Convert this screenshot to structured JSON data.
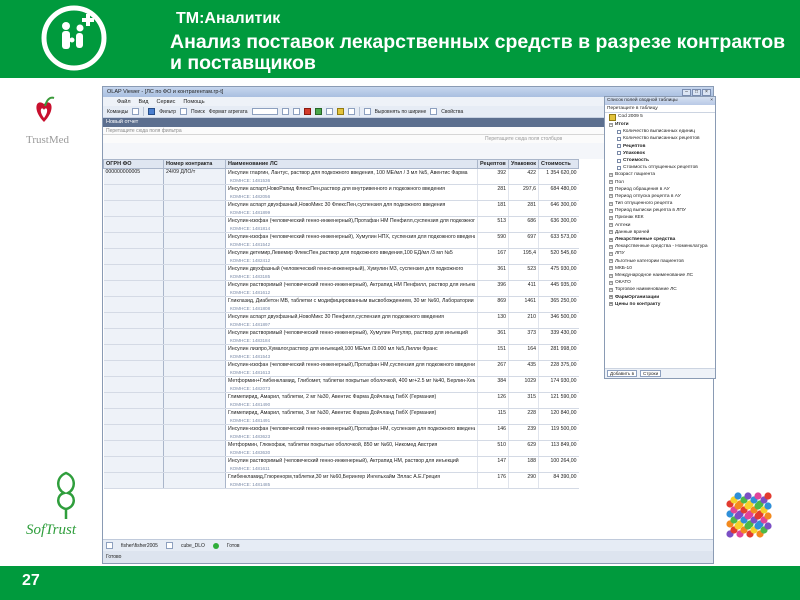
{
  "slide": {
    "app_name": "ТМ:Аналитик",
    "title": "Анализ поставок лекарственных средств в разрезе контрактов и поставщиков",
    "page_number": "27",
    "trustmed_label": "TrustMed",
    "softtrust_label": "SofTrust",
    "colors": {
      "brand_green": "#009a3d",
      "window_frame": "#8a9bb4"
    }
  },
  "window": {
    "title": "OLAP Viewer - [ЛС по ФО и контрагентам.rp-t]",
    "menu": [
      "Файл",
      "Вид",
      "Сервис",
      "Помощь"
    ],
    "toolbar": {
      "commands": "Команды",
      "filter": "Фильтр",
      "search": "Поиск",
      "format": "Формат агрегата",
      "align": "Выровнять по ширине",
      "properties": "Свойства"
    },
    "report_tab": "Новый отчет",
    "filter_zone": "Перетащите сюда поля фильтра",
    "column_zone": "Перетащите сюда поля столбцов",
    "headers": {
      "ogrn": "ОГРН ФО",
      "contract": "Номер контракта",
      "name": "Наименование ЛС",
      "recipes": "Рецептов",
      "packs": "Упаковок",
      "cost": "Стоимость"
    },
    "ogrn_value": "000000000005",
    "contract_value": "24/09 ДЛО/т",
    "rows": [
      {
        "name": "Инсулин гларгин, Лантус, раствор для подкожного введения, 100 МЕ/мл / 3 мл №5, Авентис Фарма",
        "code": "КОМНСЕ: 1481536",
        "recipes": "392",
        "packs": "422",
        "cost": "1 354 620,00"
      },
      {
        "name": "Инсулин аспарт,НовоРапид ФлексПен,раствор для внутривенного и подкожного введения",
        "code": "КОМНСЕ: 1482056",
        "recipes": "281",
        "packs": "297,6",
        "cost": "684 480,00"
      },
      {
        "name": "Инсулин аспарт двухфазный,НовоМикс 30 ФлексПен,суспензия для подкожного введения",
        "code": "КОМНСЕ: 1481899",
        "recipes": "181",
        "packs": "281",
        "cost": "646 300,00"
      },
      {
        "name": "Инсулин-изофан (человеческий генно-инженерный),Протафан НМ Пенфилл,суспензия для подкожного",
        "code": "КОМНСЕ: 1481814",
        "recipes": "513",
        "packs": "686",
        "cost": "636 300,00"
      },
      {
        "name": "Инсулин-изофан (человеческий генно-инженерный), Хумулин НПХ, суспензия для подкожного введения",
        "code": "КОМНСЕ: 1481542",
        "recipes": "590",
        "packs": "697",
        "cost": "633 573,00"
      },
      {
        "name": "Инсулин детемир,Левемир ФлексПен,раствор для подкожного введения,100 ЕД/мл /3 мл №5",
        "code": "КОМНСЕ: 1482412",
        "recipes": "167",
        "packs": "195,4",
        "cost": "520 545,60"
      },
      {
        "name": "Инсулин двухфазный (человеческий генно-инженерный), Хумулин М3, суспензия для подкожного",
        "code": "КОМНСЕ: 1483185",
        "recipes": "361",
        "packs": "523",
        "cost": "475 930,00"
      },
      {
        "name": "Инсулин растворимый (человеческий генно-инженерный), Актрапид НМ Пенфилл, раствор для инъекций",
        "code": "КОМНСЕ: 1481612",
        "recipes": "396",
        "packs": "411",
        "cost": "445 935,00"
      },
      {
        "name": "Гликлазид, Диабетон МВ, таблетки с модифицированным высвобождением, 30 мг №60, Лаборатории Сервье",
        "code": "КОМНСЕ: 1481808",
        "recipes": "869",
        "packs": "1461",
        "cost": "365 250,00"
      },
      {
        "name": "Инсулин аспарт двухфазный,НовоМикс 30 Пенфилл,суспензия для подкожного введения",
        "code": "КОМНСЕ: 1481897",
        "recipes": "130",
        "packs": "210",
        "cost": "346 500,00"
      },
      {
        "name": "Инсулин растворимый (человеческий генно-инженерный), Хумулин Регуляр, раствор для инъекций",
        "code": "КОМНСЕ: 1483184",
        "recipes": "361",
        "packs": "373",
        "cost": "339 430,00"
      },
      {
        "name": "Инсулин лизпро,Хумалог,раствор для инъекций,100 МЕ/мл /3.000 мл №5,Лилли Франс",
        "code": "КОМНСЕ: 1481543",
        "recipes": "151",
        "packs": "164",
        "cost": "281 998,00"
      },
      {
        "name": "Инсулин-изофан (человеческий генно-инженерный),Протафан НМ,суспензия для подкожного введения",
        "code": "КОМНСЕ: 1481613",
        "recipes": "267",
        "packs": "435",
        "cost": "228 375,00"
      },
      {
        "name": "Метформин+Глибенкламид, Глибомет, таблетки покрытые оболочкой, 400 мг+2.5 мг №40, Берлин-Хеми",
        "code": "КОМНСЕ: 1482073",
        "recipes": "384",
        "packs": "1029",
        "cost": "174 930,00"
      },
      {
        "name": "Глимепирид, Амарил, таблетки, 2 мг №30, Авентис Фарма Дойчланд ГмбХ (Германия)",
        "code": "КОМНСЕ: 1481490",
        "recipes": "126",
        "packs": "315",
        "cost": "121 590,00"
      },
      {
        "name": "Глимепирид, Амарил, таблетки, 3 мг №30, Авентис Фарма Дойчланд ГмбХ (Германия)",
        "code": "КОМНСЕ: 1481491",
        "recipes": "115",
        "packs": "228",
        "cost": "120 840,00"
      },
      {
        "name": "Инсулин-изофан (человеческий генно-инженерный),Протафан НМ, суспензия для подкожного введения",
        "code": "КОМНСЕ: 1483623",
        "recipes": "146",
        "packs": "239",
        "cost": "119 500,00"
      },
      {
        "name": "Метформин, Глюкофаж, таблетки покрытые оболочкой, 850 мг №60, Никомед Австрия",
        "code": "КОМНСЕ: 1483630",
        "recipes": "510",
        "packs": "629",
        "cost": "113 849,00"
      },
      {
        "name": "Инсулин растворимый (человеческий генно-инженерный), Актрапид НМ, раствор для инъекций",
        "code": "КОМНСЕ: 1481611",
        "recipes": "147",
        "packs": "188",
        "cost": "100 264,00"
      },
      {
        "name": "Глибенкламид,Глюренорм,таблетки,30 мг №60,Берингер Ингельхайм Эллас А.Е.Греция",
        "code": "КОМНСЕ: 1481485",
        "recipes": "176",
        "packs": "290",
        "cost": "84 390,00"
      }
    ],
    "status": {
      "user": "fisher\\fisher2005",
      "cube": "cube_DLO",
      "state": "Готов",
      "ready_bar": "Готово"
    }
  },
  "field_panel": {
    "title": "Список полей сводной таблицы",
    "subtitle": "Перетащите в таблицу",
    "cube_name": "Cod 2009 5",
    "items": [
      {
        "label": "Итоги",
        "bold": true,
        "kind": "group"
      },
      {
        "label": "Количество выписанных единиц",
        "bold": false,
        "kind": "check"
      },
      {
        "label": "Количество выписанных рецептов",
        "bold": false,
        "kind": "check"
      },
      {
        "label": "Рецептов",
        "bold": true,
        "kind": "check"
      },
      {
        "label": "Упаковок",
        "bold": true,
        "kind": "check"
      },
      {
        "label": "Стоимость",
        "bold": true,
        "kind": "check"
      },
      {
        "label": "Стоимость отпущенных рецептов",
        "bold": false,
        "kind": "check"
      },
      {
        "label": "Возраст пациента",
        "bold": false,
        "kind": "dim"
      },
      {
        "label": "Пол",
        "bold": false,
        "kind": "dim"
      },
      {
        "label": "Период обращения в АУ",
        "bold": false,
        "kind": "dim"
      },
      {
        "label": "Период отпуска рецепта в АУ",
        "bold": false,
        "kind": "dim"
      },
      {
        "label": "Тип отпущенного рецепта",
        "bold": false,
        "kind": "dim"
      },
      {
        "label": "Период выписки рецепта в ЛПУ",
        "bold": false,
        "kind": "dim"
      },
      {
        "label": "Признак КЕК",
        "bold": false,
        "kind": "dim"
      },
      {
        "label": "Аптеки",
        "bold": false,
        "kind": "dim"
      },
      {
        "label": "Данные врачей",
        "bold": false,
        "kind": "dim"
      },
      {
        "label": "Лекарственные средства",
        "bold": true,
        "kind": "dim"
      },
      {
        "label": "Лекарственные средства - Номенклатура",
        "bold": false,
        "kind": "dim"
      },
      {
        "label": "ЛПУ",
        "bold": false,
        "kind": "dim"
      },
      {
        "label": "Льготные категории пациентов",
        "bold": false,
        "kind": "dim"
      },
      {
        "label": "МКБ-10",
        "bold": false,
        "kind": "dim"
      },
      {
        "label": "Международное наименование ЛС",
        "bold": false,
        "kind": "dim"
      },
      {
        "label": "ОКАТО",
        "bold": false,
        "kind": "dim"
      },
      {
        "label": "Торговое наименование ЛС",
        "bold": false,
        "kind": "dim"
      },
      {
        "label": "ФармОрганизации",
        "bold": true,
        "kind": "dim"
      },
      {
        "label": "Цены по контракту",
        "bold": true,
        "kind": "dim"
      }
    ],
    "add_button": "Добавить в",
    "area_select": "Строки"
  }
}
